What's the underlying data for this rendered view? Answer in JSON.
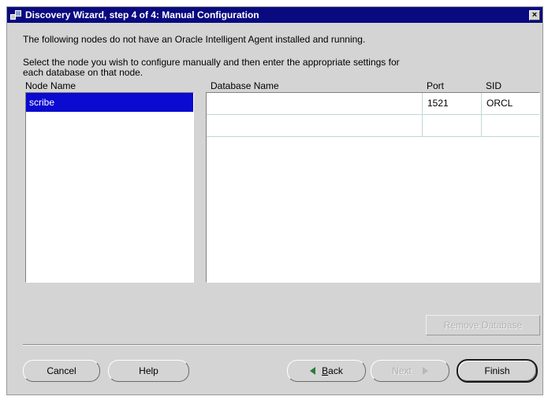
{
  "window": {
    "title": "Discovery Wizard, step 4 of 4: Manual Configuration",
    "close_label": "×",
    "app_icon": "wizard-app-icon"
  },
  "intro": {
    "line1": "The following nodes do not have an Oracle Intelligent Agent installed and running.",
    "line2": "Select the node you wish to configure manually and then enter the appropriate settings for",
    "line3": "each database on that node."
  },
  "node_list": {
    "header": "Node Name",
    "items": [
      {
        "label": "scribe",
        "selected": true
      }
    ]
  },
  "db_table": {
    "columns": [
      "Database Name",
      "Port",
      "SID"
    ],
    "rows": [
      {
        "database_name": "",
        "port": "1521",
        "sid": "ORCL"
      },
      {
        "database_name": "",
        "port": "",
        "sid": ""
      }
    ],
    "remove_label": "Remove Database"
  },
  "buttons": {
    "cancel": "Cancel",
    "help": "Help",
    "back_mnemonic": "B",
    "back_rest": "ack",
    "next": "Next",
    "finish": "Finish"
  },
  "colors": {
    "title_bar": "#0a0a80",
    "selection": "#0a0ad0",
    "dialog_bg": "#d4d4d4"
  }
}
